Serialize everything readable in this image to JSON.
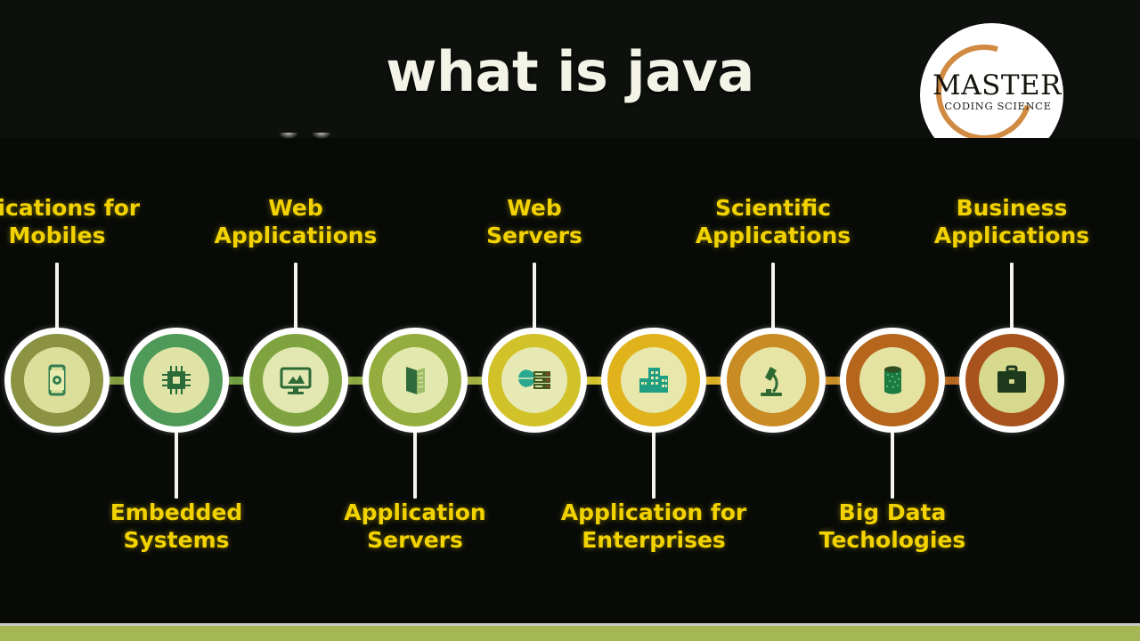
{
  "header": {
    "title": "what is java",
    "title_color": "#f3f3e7",
    "background_color": "#0d100d"
  },
  "logo": {
    "name": "MASTER",
    "tagline": "CODING SCIENCE",
    "arc_color": "#d08a42",
    "circle_color": "#ffffff",
    "icon": "master-coding-science-logo"
  },
  "diagram": {
    "background_color": "#070a07",
    "label_color": "#f2d200",
    "connector_color": "#ffffff",
    "nodes": [
      {
        "id": "applications-for-mobiles",
        "label": "plications for\nMobiles",
        "position": "top",
        "icon": "mobile-phone-icon",
        "ring_color": "#8b9342",
        "inner_color": "#dcdf9c",
        "icon_color": "#2f7d4e",
        "rail_color": "#7f9a3c"
      },
      {
        "id": "embedded-systems",
        "label": "Embedded\nSystems",
        "position": "bottom",
        "icon": "microchip-icon",
        "ring_color": "#4f9a58",
        "inner_color": "#dfe3a6",
        "icon_color": "#2b6b3a",
        "rail_color": "#6f9a3f"
      },
      {
        "id": "web-applications",
        "label": "Web\nApplicatiions",
        "position": "top",
        "icon": "desktop-monitor-icon",
        "ring_color": "#7fa43f",
        "inner_color": "#e3e8b2",
        "icon_color": "#2d6b36",
        "rail_color": "#8aa63c"
      },
      {
        "id": "application-servers",
        "label": "Application\nServers",
        "position": "bottom",
        "icon": "server-rack-icon",
        "ring_color": "#94ad3e",
        "inner_color": "#e2e8ae",
        "icon_color": "#2e6a3b",
        "rail_color": "#a0ae3d"
      },
      {
        "id": "web-servers",
        "label": "Web\nServers",
        "position": "top",
        "icon": "globe-server-icon",
        "ring_color": "#d2c22a",
        "inner_color": "#e7e9b4",
        "icon_color": "#2aa88f",
        "rail_color": "#d2c22a"
      },
      {
        "id": "application-for-enterprises",
        "label": "Application for\nEnterprises",
        "position": "bottom",
        "icon": "office-buildings-icon",
        "ring_color": "#e0b21c",
        "inner_color": "#e8e7ac",
        "icon_color": "#1f9e84",
        "rail_color": "#dcae22"
      },
      {
        "id": "scientific-applications",
        "label": "Scientific\nApplications",
        "position": "top",
        "icon": "microscope-icon",
        "ring_color": "#c98b23",
        "inner_color": "#e7e5a6",
        "icon_color": "#2f6a33",
        "rail_color": "#c98b23"
      },
      {
        "id": "big-data-technologies",
        "label": "Big Data\nTechologies",
        "position": "bottom",
        "icon": "database-cylinder-icon",
        "ring_color": "#b5651c",
        "inner_color": "#e4e3a2",
        "icon_color": "#1d7a41",
        "rail_color": "#b5651c"
      },
      {
        "id": "business-applications",
        "label": "Business\nApplications",
        "position": "top",
        "icon": "briefcase-icon",
        "ring_color": "#a8531d",
        "inner_color": "#d7d98f",
        "icon_color": "#1d3a1c",
        "rail_color": "#a8531d"
      }
    ]
  },
  "footer": {
    "band_color": "#a5b755",
    "line_color": "#c9c9c4"
  }
}
